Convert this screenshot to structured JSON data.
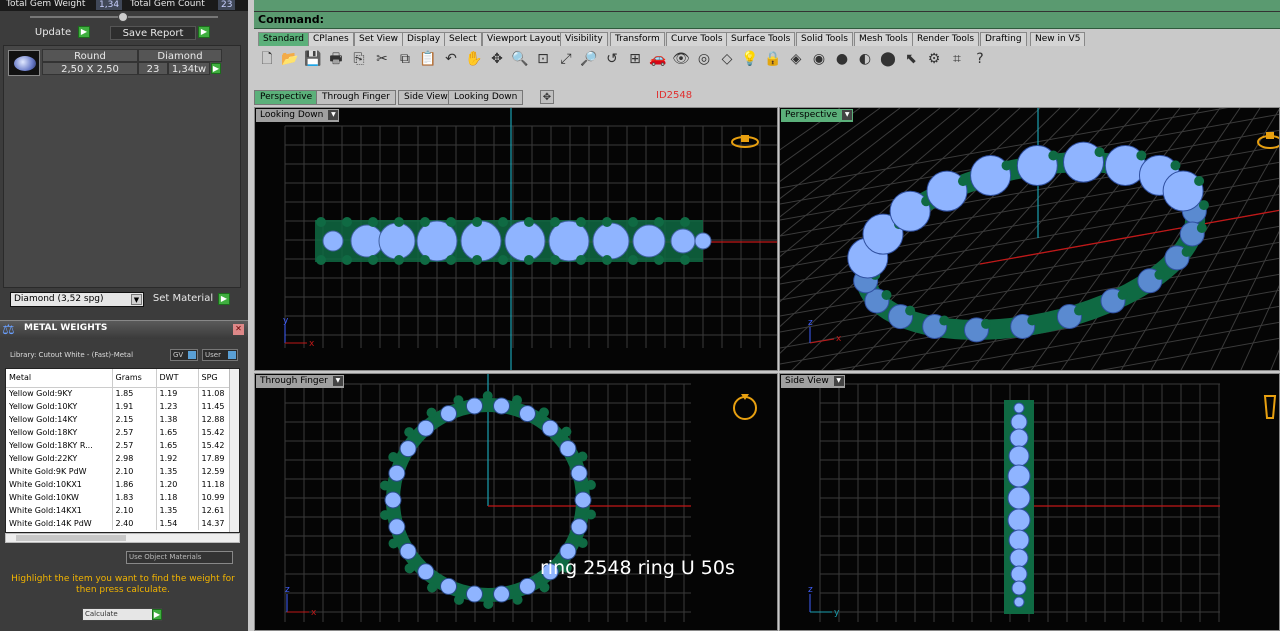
{
  "gem_header": {
    "weight_label": "Total Gem Weight",
    "weight_value": "1,34",
    "count_label": "Total Gem Count",
    "count_value": "23"
  },
  "gem_buttons": {
    "update": "Update",
    "save_report": "Save Report"
  },
  "gem_table": {
    "col1": "Round",
    "col2": "Diamond",
    "size": "2,50 X 2,50",
    "count": "23",
    "weight": "1,34tw"
  },
  "material_select": {
    "value": "Diamond    (3,52 spg)",
    "set_label": "Set Material"
  },
  "metal_weights": {
    "title": "METAL WEIGHTS",
    "library": "Library: Cutout White - (Fast)-Metal",
    "gv_btn": "GV",
    "user_btn": "User",
    "columns": [
      "Metal",
      "Grams",
      "DWT",
      "SPG"
    ],
    "rows": [
      [
        "Yellow Gold:9KY",
        "1.85",
        "1.19",
        "11.08"
      ],
      [
        "Yellow Gold:10KY",
        "1.91",
        "1.23",
        "11.45"
      ],
      [
        "Yellow Gold:14KY",
        "2.15",
        "1.38",
        "12.88"
      ],
      [
        "Yellow Gold:18KY",
        "2.57",
        "1.65",
        "15.42"
      ],
      [
        "Yellow Gold:18KY R...",
        "2.57",
        "1.65",
        "15.42"
      ],
      [
        "Yellow Gold:22KY",
        "2.98",
        "1.92",
        "17.89"
      ],
      [
        "White Gold:9K PdW",
        "2.10",
        "1.35",
        "12.59"
      ],
      [
        "White Gold:10KX1",
        "1.86",
        "1.20",
        "11.18"
      ],
      [
        "White Gold:10KW",
        "1.83",
        "1.18",
        "10.99"
      ],
      [
        "White Gold:14KX1",
        "2.10",
        "1.35",
        "12.61"
      ],
      [
        "White Gold:14K PdW",
        "2.40",
        "1.54",
        "14.37"
      ]
    ],
    "use_obj": "Use Object Materials",
    "hint": "Highlight the item you want to find the weight for then press calculate.",
    "calculate": "Calculate"
  },
  "command_label": "Command:",
  "toolbar_tabs": [
    "Standard",
    "CPlanes",
    "Set View",
    "Display",
    "Select",
    "Viewport Layout",
    "Visibility",
    "Transform",
    "Curve Tools",
    "Surface Tools",
    "Solid Tools",
    "Mesh Tools",
    "Render Tools",
    "Drafting",
    "New in V5"
  ],
  "viewport_tabs": [
    "Perspective",
    "Through Finger",
    "Side View",
    "Looking Down"
  ],
  "id_label": "ID2548",
  "viewports": {
    "tl": "Looking Down",
    "tr": "Perspective",
    "bl": "Through Finger",
    "br": "Side View"
  },
  "caption": "ring 2548 ring U 50s",
  "colors": {
    "accent_green": "#5bb07a",
    "gem_blue": "#8fb4ff",
    "prong_green": "#0f6a43",
    "axis_red": "#c01818",
    "axis_teal": "#1aa0b0"
  }
}
